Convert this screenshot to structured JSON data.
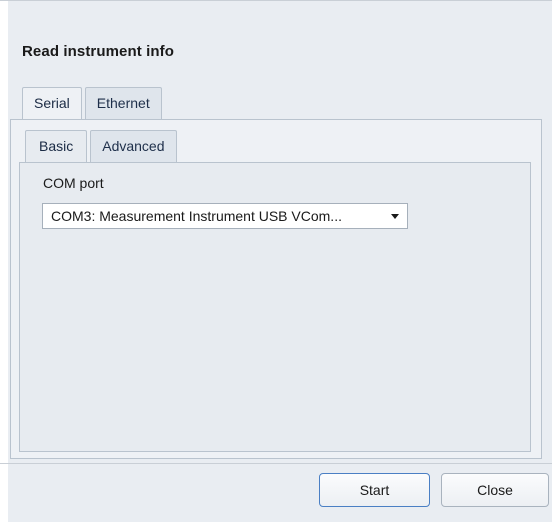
{
  "dialog": {
    "title": "Read instrument info"
  },
  "outer_tabs": [
    {
      "label": "Serial",
      "active": true
    },
    {
      "label": "Ethernet",
      "active": false
    }
  ],
  "inner_tabs": [
    {
      "label": "Basic",
      "active": true
    },
    {
      "label": "Advanced",
      "active": false
    }
  ],
  "com_port": {
    "label": "COM port",
    "selected_value": "COM3: Measurement Instrument USB VCom..."
  },
  "buttons": {
    "start_label": "Start",
    "close_label": "Close"
  },
  "icons": {
    "dropdown": "chevron-down-icon"
  }
}
